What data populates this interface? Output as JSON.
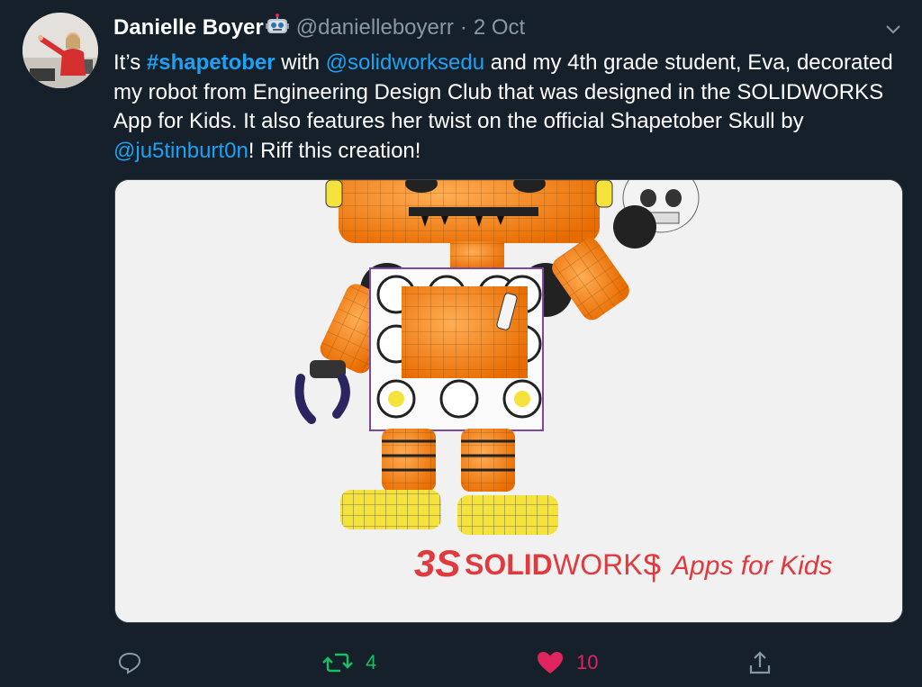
{
  "tweet": {
    "author_name": "Danielle Boyer",
    "author_emoji": "robot-face",
    "author_handle": "@danielleboyerr",
    "separator": "·",
    "date": "2 Oct",
    "text": {
      "p1": "It’s ",
      "hashtag": "#shapetober",
      "p2": " with ",
      "mention1": "@solidworksedu",
      "p3": " and my 4th grade student, Eva, decorated my robot from Engineering Design Club that was designed in the SOLIDWORKS App for Kids. It also features her twist on the official Shapetober Skull by ",
      "mention2": "@ju5tinburt0n",
      "p4": "! Riff this creation!"
    }
  },
  "media": {
    "logo_mark": "3S",
    "logo_solid": "SOLID",
    "logo_works": "WORKS",
    "logo_divider": "|",
    "logo_apps": "Apps for Kids"
  },
  "actions": {
    "reply_icon": "reply-icon",
    "retweet_icon": "retweet-icon",
    "retweet_count": "4",
    "like_icon": "heart-icon",
    "like_count": "10",
    "share_icon": "share-icon"
  },
  "colors": {
    "background": "#15202b",
    "link": "#1da1f2",
    "secondary_text": "#8899a6",
    "retweet_green": "#17bf63",
    "like_red": "#e0245e",
    "robot_orange": "#f7871f",
    "robot_yellow": "#f5e23b"
  }
}
